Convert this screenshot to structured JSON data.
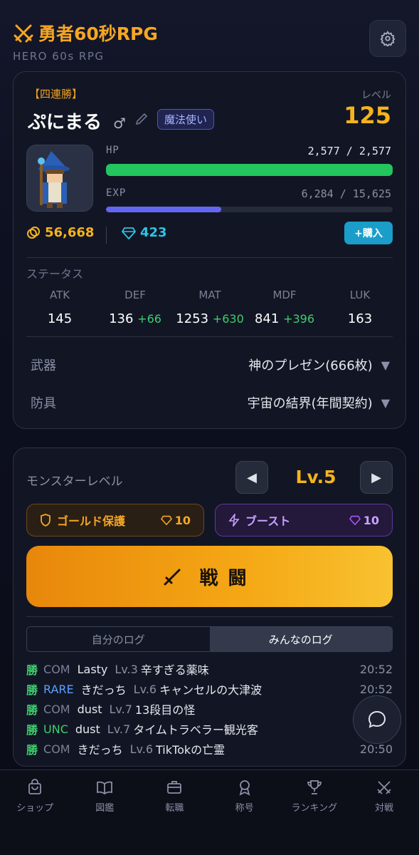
{
  "header": {
    "title": "勇者60秒RPG",
    "subtitle": "HERO 60s RPG"
  },
  "player": {
    "title_badge": "【四連勝】",
    "name": "ぷにまる",
    "gender_symbol": "♂",
    "class_badge": "魔法使い",
    "level_label": "レベル",
    "level": "125",
    "hp_label": "HP",
    "hp_text": "2,577 / 2,577",
    "hp_fraction": 1.0,
    "exp_label": "EXP",
    "exp_text": "6,284 / 15,625",
    "exp_fraction": 0.402,
    "gold": "56,668",
    "gems": "423",
    "buy_label": "+購入"
  },
  "status": {
    "section_label": "ステータス",
    "stats": [
      {
        "name": "ATK",
        "value": "145",
        "bonus": ""
      },
      {
        "name": "DEF",
        "value": "136",
        "bonus": "+66"
      },
      {
        "name": "MAT",
        "value": "1253",
        "bonus": "+630"
      },
      {
        "name": "MDF",
        "value": "841",
        "bonus": "+396"
      },
      {
        "name": "LUK",
        "value": "163",
        "bonus": ""
      }
    ]
  },
  "equipment": {
    "weapon_label": "武器",
    "weapon_value": "神のプレゼン(666枚)",
    "armor_label": "防具",
    "armor_value": "宇宙の結界(年間契約)"
  },
  "battle": {
    "monster_level_label": "モンスターレベル",
    "monster_level": "Lv.5",
    "gold_protect_label": "ゴールド保護",
    "gold_protect_cost": "10",
    "boost_label": "ブースト",
    "boost_cost": "10",
    "battle_label": "戦闘"
  },
  "log_tabs": {
    "mine": "自分のログ",
    "all": "みんなのログ"
  },
  "logs": [
    {
      "result": "勝",
      "rarity": "COM",
      "rarity_color": "#7a8096",
      "player": "Lasty",
      "level": "Lv.3",
      "monster": "辛すぎる薬味",
      "time": "20:52"
    },
    {
      "result": "勝",
      "rarity": "RARE",
      "rarity_color": "#5aa0ff",
      "player": "きだっち",
      "level": "Lv.6",
      "monster": "キャンセルの大津波",
      "time": "20:52"
    },
    {
      "result": "勝",
      "rarity": "COM",
      "rarity_color": "#7a8096",
      "player": "dust",
      "level": "Lv.7",
      "monster": "13段目の怪",
      "time": ""
    },
    {
      "result": "勝",
      "rarity": "UNC",
      "rarity_color": "#3ecf6e",
      "player": "dust",
      "level": "Lv.7",
      "monster": "タイムトラベラー観光客",
      "time": ""
    },
    {
      "result": "勝",
      "rarity": "COM",
      "rarity_color": "#7a8096",
      "player": "きだっち",
      "level": "Lv.6",
      "monster": "TikTokの亡霊",
      "time": "20:50"
    }
  ],
  "nav": [
    {
      "label": "ショップ",
      "icon": "bag-icon"
    },
    {
      "label": "図鑑",
      "icon": "book-icon"
    },
    {
      "label": "転職",
      "icon": "briefcase-icon"
    },
    {
      "label": "称号",
      "icon": "medal-icon"
    },
    {
      "label": "ランキング",
      "icon": "trophy-icon"
    },
    {
      "label": "対戦",
      "icon": "crossed-swords-icon"
    }
  ]
}
